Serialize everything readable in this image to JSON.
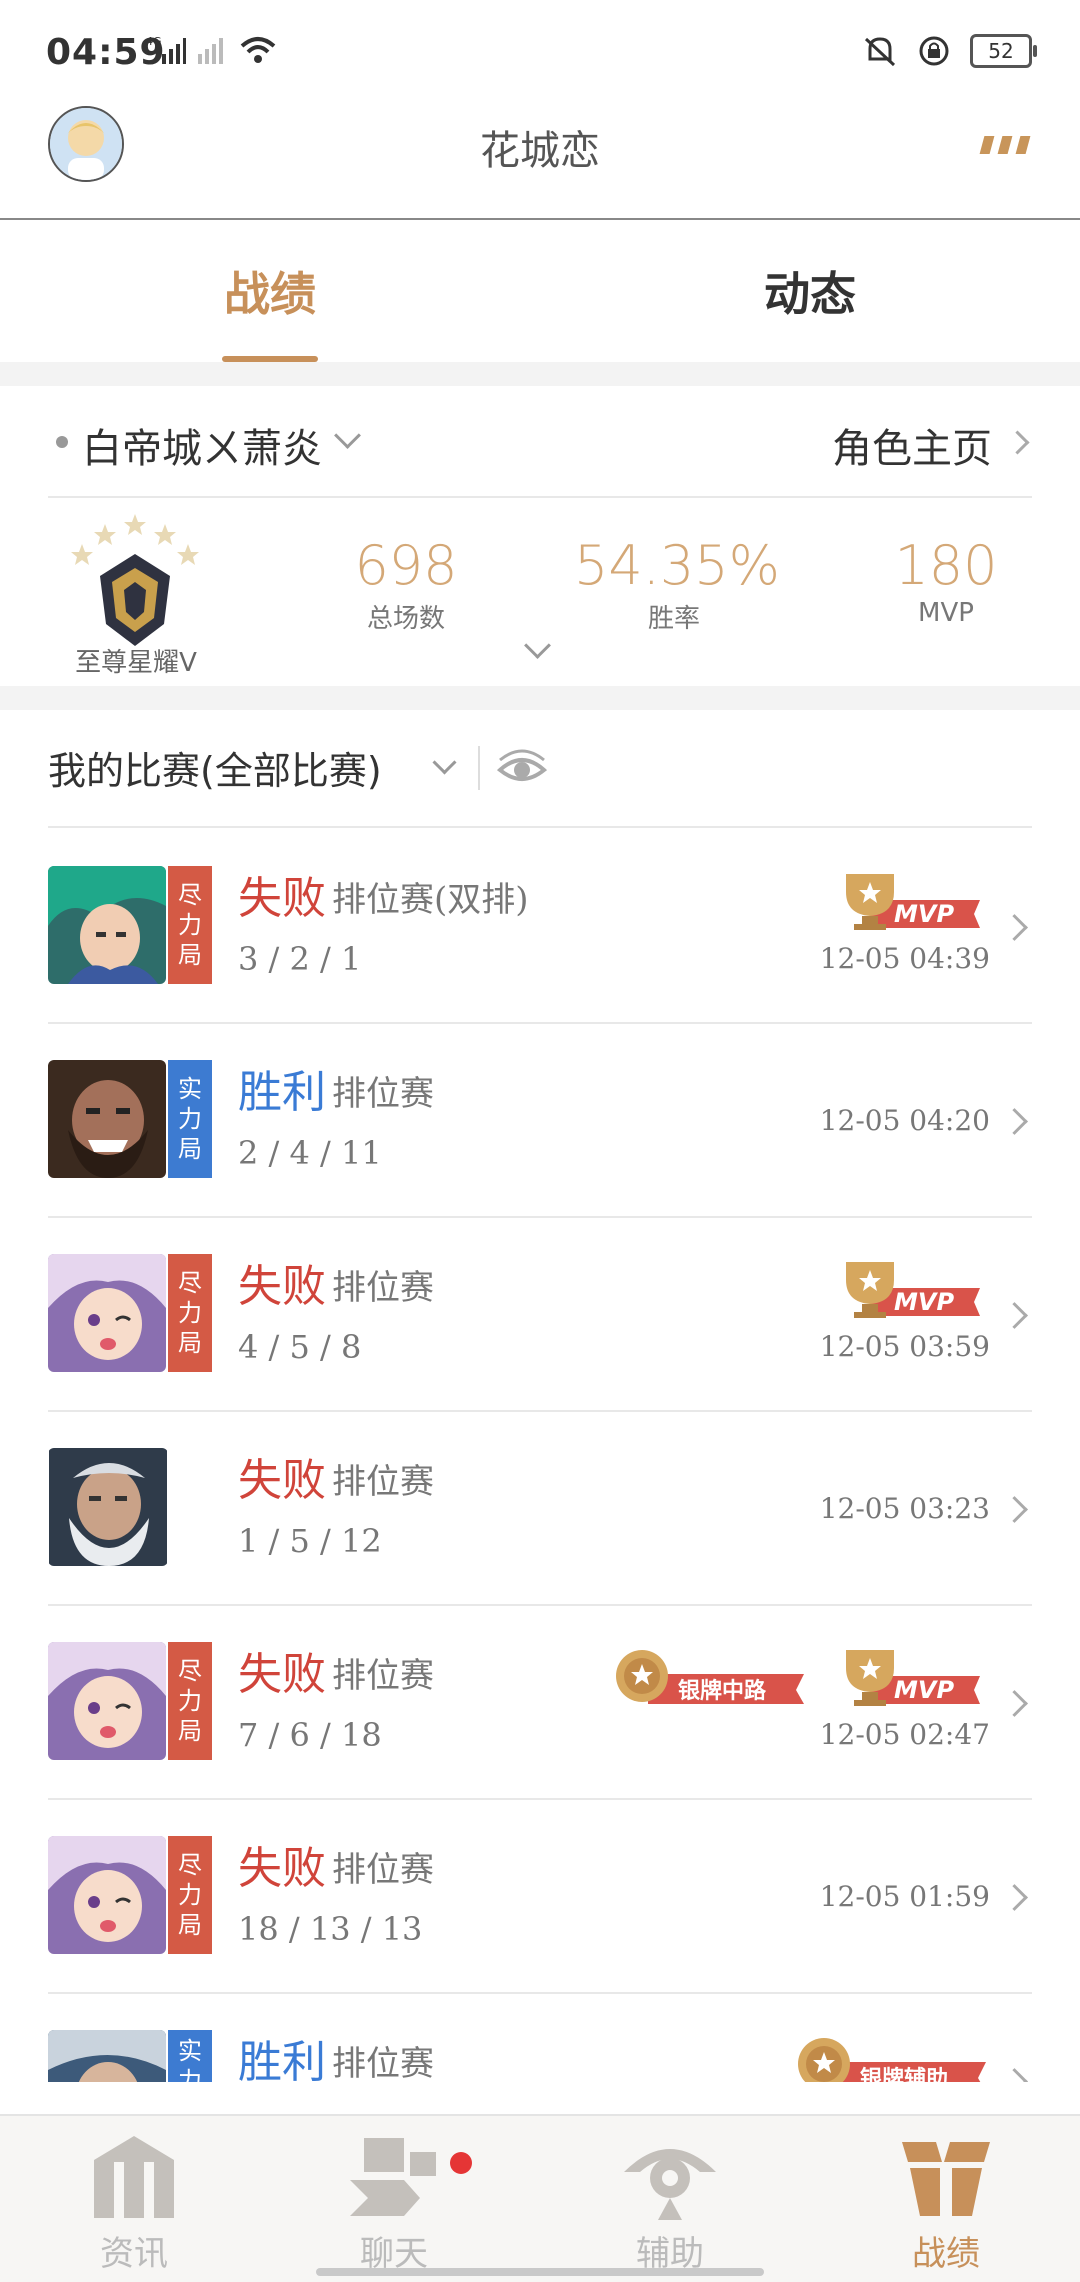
{
  "status_bar": {
    "time": "04:59",
    "network": "4G",
    "battery": "52"
  },
  "header": {
    "title": "花城恋"
  },
  "tabs": [
    {
      "label": "战绩",
      "active": true
    },
    {
      "label": "动态",
      "active": false
    }
  ],
  "profile": {
    "player_name": "白帝城ㄨ萧炎",
    "role_link": "角色主页",
    "rank": "至尊星耀V",
    "stats": {
      "total_games": {
        "value": "698",
        "label": "总场数"
      },
      "win_rate": {
        "value": "54.35%",
        "label": "胜率"
      },
      "mvp": {
        "value": "180",
        "label": "MVP"
      }
    }
  },
  "matches_section": {
    "title": "我的比赛(全部比赛)"
  },
  "badges": {
    "mvp": "MVP",
    "silver_mid": "银牌中路",
    "silver_support": "银牌辅助"
  },
  "matches": [
    {
      "result": "失败",
      "mode": "排位赛(双排)",
      "kda": "3 / 2 / 1",
      "time": "12-05 04:39",
      "tag": "尽力局",
      "mvp": true
    },
    {
      "result": "胜利",
      "mode": "排位赛",
      "kda": "2 / 4 / 11",
      "time": "12-05 04:20",
      "tag": "实力局",
      "mvp": false
    },
    {
      "result": "失败",
      "mode": "排位赛",
      "kda": "4 / 5 / 8",
      "time": "12-05 03:59",
      "tag": "尽力局",
      "mvp": true
    },
    {
      "result": "失败",
      "mode": "排位赛",
      "kda": "1 / 5 / 12",
      "time": "12-05 03:23",
      "tag": "",
      "mvp": false
    },
    {
      "result": "失败",
      "mode": "排位赛",
      "kda": "7 / 6 / 18",
      "time": "12-05 02:47",
      "tag": "尽力局",
      "mvp": true
    },
    {
      "result": "失败",
      "mode": "排位赛",
      "kda": "18 / 13 / 13",
      "time": "12-05 01:59",
      "tag": "尽力局",
      "mvp": false
    },
    {
      "result": "胜利",
      "mode": "排位赛",
      "kda": "",
      "time": "",
      "tag": "实力局",
      "mvp": false
    }
  ],
  "bottom_nav": [
    {
      "label": "资讯",
      "icon": "news-icon",
      "active": false
    },
    {
      "label": "聊天",
      "icon": "chat-icon",
      "active": false
    },
    {
      "label": "辅助",
      "icon": "assist-icon",
      "active": false
    },
    {
      "label": "战绩",
      "icon": "record-icon",
      "active": true
    }
  ],
  "colors": {
    "accent": "#c7905a",
    "loss": "#d0443a",
    "win": "#3a7bd5"
  }
}
